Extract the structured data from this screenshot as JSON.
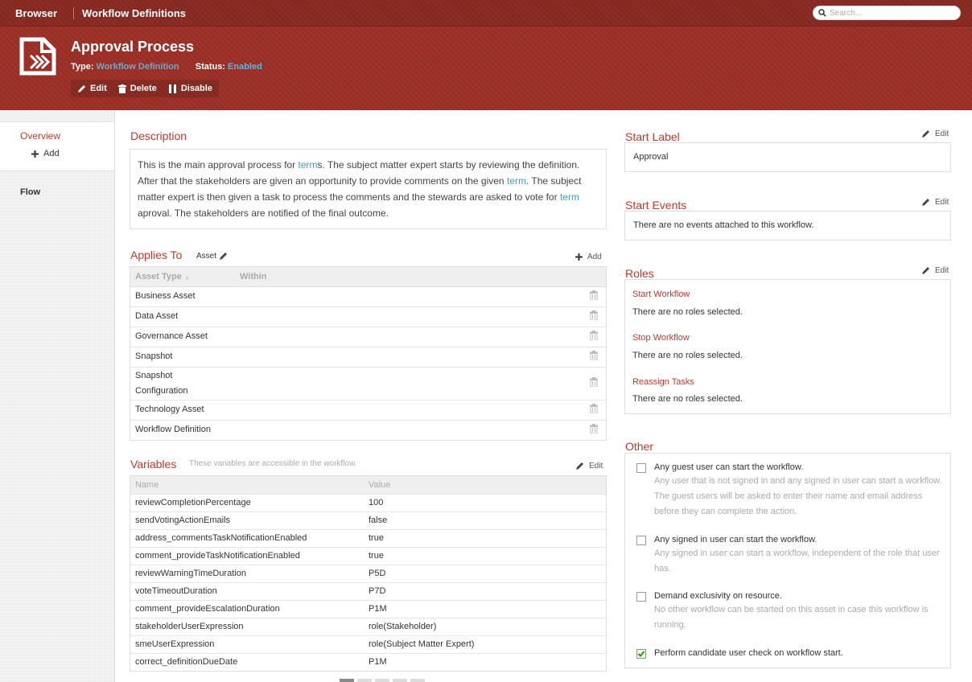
{
  "nav": {
    "browser": "Browser",
    "breadcrumb": "Workflow Definitions",
    "search_placeholder": "Search..."
  },
  "header": {
    "title": "Approval Process",
    "type_label": "Type:",
    "type_value": "Workflow Definition",
    "status_label": "Status:",
    "status_value": "Enabled",
    "actions": {
      "edit": "Edit",
      "delete": "Delete",
      "disable": "Disable"
    }
  },
  "sidebar": {
    "overview": "Overview",
    "add": "Add",
    "flow": "Flow"
  },
  "description": {
    "heading": "Description",
    "p1": "This is the main approval process for ",
    "link1": "term",
    "p2": "s. The subject matter expert starts by reviewing the definition. After that the stakeholders are given an opportunity to provide comments on the given ",
    "link2": "term",
    "p3": ". The subject matter expert is then given a task to process the comments and the stewards are asked to vote for ",
    "link3": "term",
    "p4": " aproval. The stakeholders are notified of the final outcome."
  },
  "applies_to": {
    "heading": "Applies To",
    "asset_label": "Asset",
    "add": "Add",
    "columns": [
      "Asset Type",
      "Within"
    ],
    "rows": [
      "Business Asset",
      "Data Asset",
      "Governance Asset",
      "Snapshot",
      "Snapshot Configuration",
      "Technology Asset",
      "Workflow Definition"
    ]
  },
  "variables": {
    "heading": "Variables",
    "hint": "These variables are accessible in the workflow.",
    "edit": "Edit",
    "columns": [
      "Name",
      "Value"
    ],
    "rows": [
      [
        "reviewCompletionPercentage",
        "100"
      ],
      [
        "sendVotingActionEmails",
        "false"
      ],
      [
        "address_commentsTaskNotificationEnabled",
        "true"
      ],
      [
        "comment_provideTaskNotificationEnabled",
        "true"
      ],
      [
        "reviewWarningTimeDuration",
        "P5D"
      ],
      [
        "voteTimeoutDuration",
        "P7D"
      ],
      [
        "comment_provideEscalationDuration",
        "P1M"
      ],
      [
        "stakeholderUserExpression",
        "role(Stakeholder)"
      ],
      [
        "smeUserExpression",
        "role(Subject Matter Expert)"
      ],
      [
        "correct_definitionDueDate",
        "P1M"
      ]
    ]
  },
  "start_label": {
    "heading": "Start Label",
    "edit": "Edit",
    "value": "Approval"
  },
  "start_events": {
    "heading": "Start Events",
    "edit": "Edit",
    "value": "There are no events attached to this workflow."
  },
  "roles": {
    "heading": "Roles",
    "edit": "Edit",
    "items": [
      {
        "title": "Start Workflow",
        "value": "There are no roles selected."
      },
      {
        "title": "Stop Workflow",
        "value": "There are no roles selected."
      },
      {
        "title": "Reassign Tasks",
        "value": "There are no roles selected."
      }
    ]
  },
  "other": {
    "heading": "Other",
    "options": [
      {
        "label": "Any guest user can start the workflow.",
        "desc": "Any user that is not signed in and any signed in user can start a workflow. The guest users will be asked to enter their name and email address before they can complete the action.",
        "checked": false
      },
      {
        "label": "Any signed in user can start the workflow.",
        "desc": "Any signed in user can start a workflow, independent of the role that user has.",
        "checked": false
      },
      {
        "label": "Demand exclusivity on resource.",
        "desc": "No other workflow can be started on this asset in case this workflow is running.",
        "checked": false
      },
      {
        "label": "Perform candidate user check on workflow start.",
        "desc": "",
        "checked": true
      }
    ]
  },
  "colors": {
    "brand": "#9b2f26",
    "accent": "#c0392b",
    "link": "#3c9bd6"
  }
}
